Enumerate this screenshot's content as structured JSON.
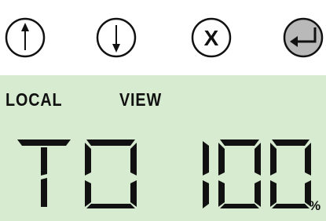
{
  "buttons": [
    {
      "id": "up",
      "icon": "arrow-up-icon"
    },
    {
      "id": "down",
      "icon": "arrow-down-icon"
    },
    {
      "id": "cancel",
      "icon": "x-icon",
      "label": "X"
    },
    {
      "id": "enter",
      "icon": "enter-icon"
    }
  ],
  "lcd": {
    "status_left": "LOCAL",
    "status_right": "VIEW",
    "mode_text": "TO",
    "value_text": "100",
    "unit": "%",
    "background": "#d6ebd0"
  }
}
